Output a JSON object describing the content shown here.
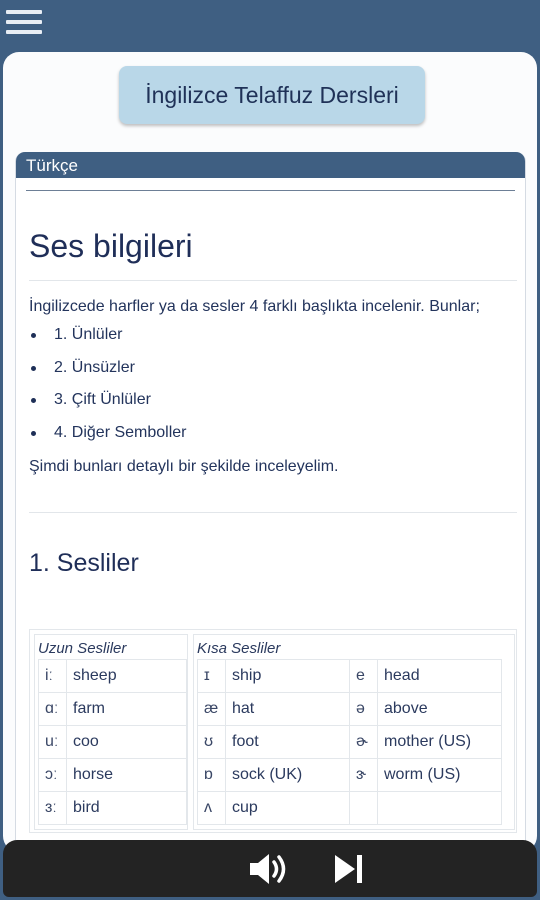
{
  "app": {
    "title": "İngilizce Telaffuz Dersleri"
  },
  "panel": {
    "language": "Türkçe"
  },
  "content": {
    "heading": "Ses bilgileri",
    "intro": "İngilizcede harfler ya da sesler 4 farklı başlıkta incelenir. Bunlar;",
    "items": [
      "1. Ünlüler",
      "2. Ünsüzler",
      "3. Çift Ünlüler",
      "4. Diğer Semboller"
    ],
    "outro": "Şimdi bunları detaylı bir şekilde inceleyelim.",
    "section_heading": "1. Sesliler"
  },
  "long_vowels": {
    "title": "Uzun Sesliler",
    "rows": [
      {
        "sym": "iː",
        "word": "sheep"
      },
      {
        "sym": "ɑː",
        "word": "farm"
      },
      {
        "sym": "uː",
        "word": "coo"
      },
      {
        "sym": "ɔː",
        "word": "horse"
      },
      {
        "sym": "ɜː",
        "word": "bird"
      }
    ]
  },
  "short_vowels": {
    "title": "Kısa Sesliler",
    "rows": [
      {
        "sym1": "ɪ",
        "word1": "ship",
        "sym2": "e",
        "word2": "head"
      },
      {
        "sym1": "æ",
        "word1": "hat",
        "sym2": "ə",
        "word2": "above"
      },
      {
        "sym1": "ʊ",
        "word1": "foot",
        "sym2": "ɚ",
        "word2": "mother (US)"
      },
      {
        "sym1": "ɒ",
        "word1": "sock (UK)",
        "sym2": "ɝ",
        "word2": "worm (US)"
      },
      {
        "sym1": "ʌ",
        "word1": "cup",
        "sym2": "",
        "word2": ""
      }
    ]
  },
  "icons": {
    "menu": "hamburger-menu-icon",
    "speaker": "speaker-icon",
    "next": "skip-next-icon"
  },
  "colors": {
    "header": "#3f5f82",
    "title_button": "#b9d7e8",
    "bottom_bar": "#232323"
  }
}
